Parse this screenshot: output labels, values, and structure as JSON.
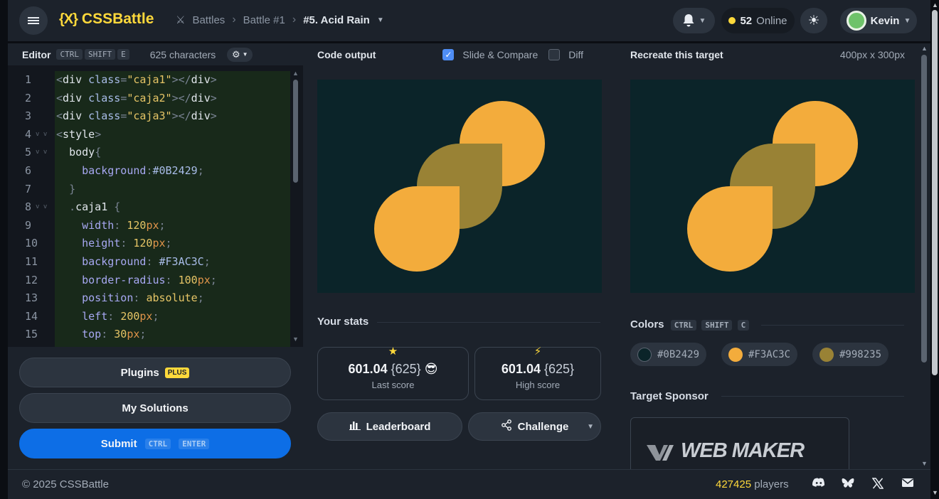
{
  "topbar": {
    "logo_mark": "{X}",
    "logo_text": "CSSBattle",
    "crumbs": [
      "Battles",
      "Battle #1",
      "#5. Acid Rain"
    ],
    "online_count": "52",
    "online_label": "Online",
    "user_name": "Kevin"
  },
  "editor": {
    "title": "Editor",
    "shortcut": [
      "CTRL",
      "SHIFT",
      "E"
    ],
    "characters": "625 characters",
    "line_numbers": [
      "1",
      "2",
      "3",
      "4",
      "5",
      "6",
      "7",
      "8",
      "9",
      "10",
      "11",
      "12",
      "13",
      "14",
      "15"
    ]
  },
  "left_buttons": {
    "plugins": "Plugins",
    "plugins_badge": "PLUS",
    "my_solutions": "My Solutions",
    "submit": "Submit",
    "submit_keys": [
      "CTRL",
      "ENTER"
    ]
  },
  "output": {
    "title": "Code output",
    "slide_compare": "Slide & Compare",
    "slide_compare_checked": true,
    "diff": "Diff",
    "diff_checked": false
  },
  "stats": {
    "title": "Your stats",
    "last_score": "601.04",
    "last_chars": "{625}",
    "last_label": "Last score",
    "high_score": "601.04",
    "high_chars": "{625}",
    "high_label": "High score",
    "leaderboard": "Leaderboard",
    "challenge": "Challenge"
  },
  "target": {
    "title": "Recreate this target",
    "size": "400px x 300px",
    "colors_title": "Colors",
    "colors_keys": [
      "CTRL",
      "SHIFT",
      "C"
    ],
    "colors": [
      "#0B2429",
      "#F3AC3C",
      "#998235"
    ],
    "sponsor_title": "Target Sponsor",
    "sponsor_name": "WEB MAKER"
  },
  "footer": {
    "copyright": "© 2025 CSSBattle",
    "players_count": "427425",
    "players_label": "players"
  }
}
